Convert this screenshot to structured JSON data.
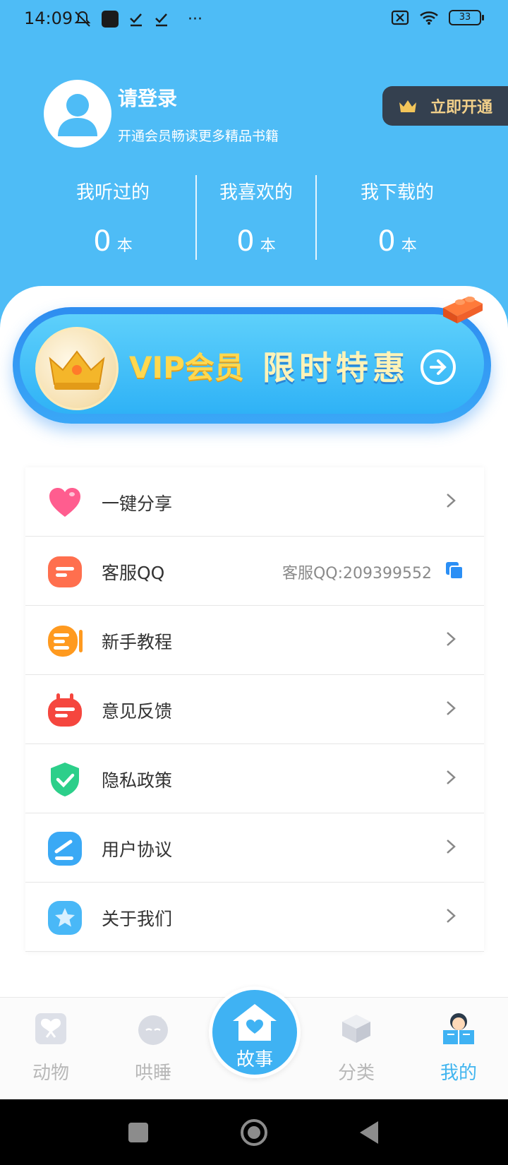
{
  "status_bar": {
    "time": "14:09",
    "battery": "33",
    "left_icons": [
      "mute-bell-icon",
      "app-square-icon",
      "check-icon",
      "check-icon",
      "more-dots-icon"
    ],
    "right_icons": [
      "sim-off-icon",
      "wifi-icon",
      "battery-icon"
    ],
    "dots": "···"
  },
  "profile": {
    "title": "请登录",
    "subtitle": "开通会员畅读更多精品书籍",
    "vip_button": "立即开通"
  },
  "stats": [
    {
      "label": "我听过的",
      "value": "0",
      "unit": "本"
    },
    {
      "label": "我喜欢的",
      "value": "0",
      "unit": "本"
    },
    {
      "label": "我下载的",
      "value": "0",
      "unit": "本"
    }
  ],
  "vip_banner": {
    "title": "VIP会员",
    "promo": "限时特惠"
  },
  "menu": [
    {
      "label": "一键分享",
      "icon": "heart-icon",
      "color": "#ff5d8f"
    },
    {
      "label": "客服QQ",
      "icon": "chat-icon",
      "color": "#ff6f4e",
      "extra": "客服QQ:209399552"
    },
    {
      "label": "新手教程",
      "icon": "tutorial-icon",
      "color": "#ff9a1f"
    },
    {
      "label": "意见反馈",
      "icon": "feedback-icon",
      "color": "#f5463e"
    },
    {
      "label": "隐私政策",
      "icon": "shield-check-icon",
      "color": "#2ccf8a"
    },
    {
      "label": "用户协议",
      "icon": "agreement-icon",
      "color": "#3aa9f5"
    },
    {
      "label": "关于我们",
      "icon": "star-icon",
      "color": "#49b8f7"
    }
  ],
  "bottom_nav": [
    {
      "label": "动物",
      "icon": "butterfly-icon",
      "active": false
    },
    {
      "label": "哄睡",
      "icon": "moon-icon",
      "active": false
    },
    {
      "label": "故事",
      "icon": "house-heart-icon",
      "active": false
    },
    {
      "label": "分类",
      "icon": "cube-icon",
      "active": false
    },
    {
      "label": "我的",
      "icon": "reader-icon",
      "active": true
    }
  ],
  "colors": {
    "header_bg": "#4ebcf6",
    "accent": "#41b5ef",
    "vip_dark": "#34404f",
    "vip_gold": "#f2d08a"
  }
}
